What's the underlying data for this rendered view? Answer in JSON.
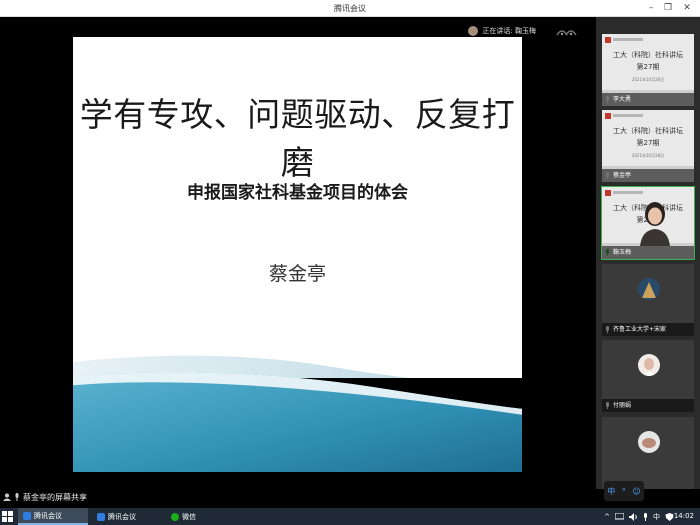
{
  "window": {
    "title": "腾讯会议",
    "minimize": "–",
    "restore": "❐",
    "close": "✕"
  },
  "speaking": {
    "label": "正在讲话: 鞠玉梅"
  },
  "slide": {
    "title": "学有专攻、问题驱动、反复打磨",
    "subtitle": "申报国家社科基金项目的体会",
    "author": "蔡金亭"
  },
  "participants": [
    {
      "name": "李大勇",
      "line1": "工大（科院）社科讲坛",
      "line2": "第27期",
      "line3": "2021年10月28日"
    },
    {
      "name": "蔡金亭",
      "line1": "工大（科院）社科讲坛",
      "line2": "第27期",
      "line3": "2021年10月28日"
    },
    {
      "name": "鞠玉梅",
      "line1": "工大（科院）社科讲坛",
      "line2": "第27期"
    },
    {
      "name": "齐鲁工业大学+宋家"
    },
    {
      "name": "付丽娟"
    },
    {
      "name": ""
    }
  ],
  "mini_toolbar": {
    "item1": "中",
    "item2": "°",
    "item3": "☺"
  },
  "share_bar": {
    "label": "蔡金亭的屏幕共享"
  },
  "taskbar": {
    "tasks": [
      "腾讯会议",
      "腾讯会议",
      "微信"
    ],
    "tray_up": "^",
    "tray_lang": "中",
    "clock": "14:02"
  },
  "colors": {
    "accent_green": "#3bb24c",
    "slide_blue": "#3d9fc0",
    "taskbar_bg": "#1f2a36"
  }
}
